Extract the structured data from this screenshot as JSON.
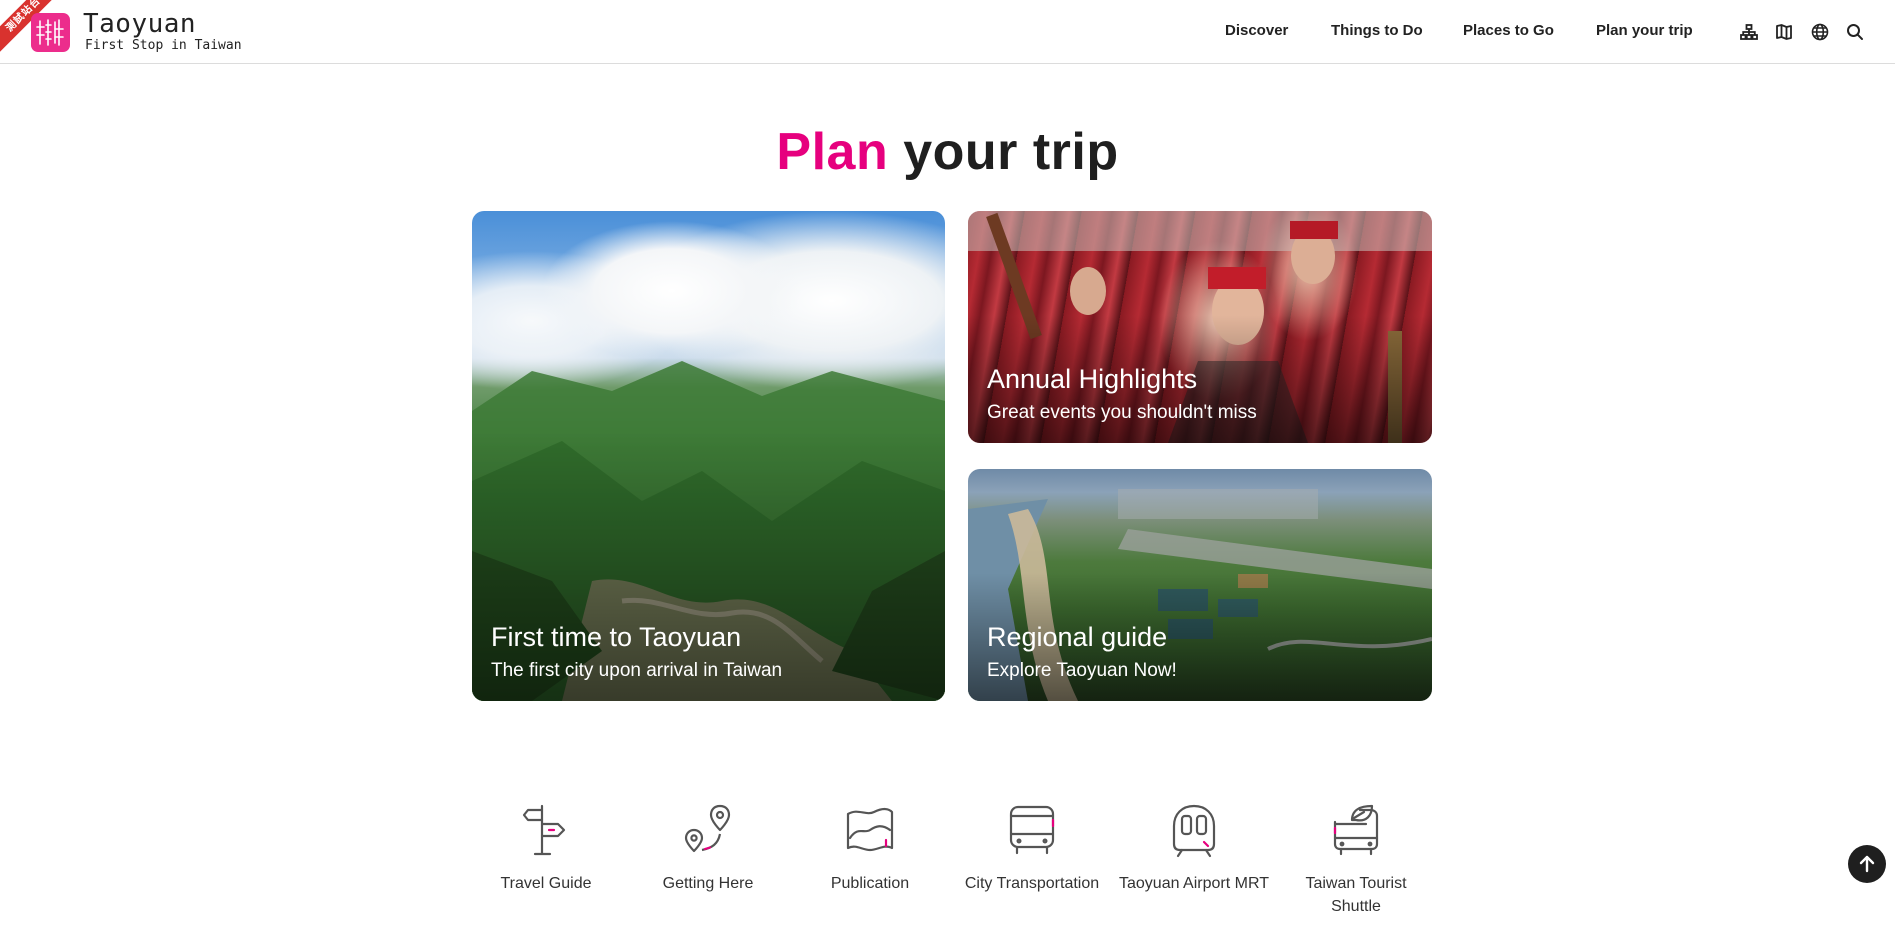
{
  "header": {
    "ribbon": "測試站台",
    "brand_title": "Taoyuan",
    "brand_tagline": "First Stop in Taiwan",
    "nav": [
      "Discover",
      "Things to Do",
      "Places to Go",
      "Plan your trip"
    ],
    "icons": [
      "sitemap-icon",
      "map-icon",
      "globe-icon",
      "search-icon"
    ]
  },
  "title": {
    "accent": "Plan",
    "rest": "your trip"
  },
  "cards": [
    {
      "title": "First time to Taoyuan",
      "subtitle": "The first city upon arrival in Taiwan"
    },
    {
      "title": "Annual Highlights",
      "subtitle": "Great events you shouldn't miss"
    },
    {
      "title": "Regional guide",
      "subtitle": "Explore Taoyuan Now!"
    }
  ],
  "quick_links": [
    {
      "label": "Travel Guide",
      "icon": "signpost-icon"
    },
    {
      "label": "Getting Here",
      "icon": "route-pins-icon"
    },
    {
      "label": "Publication",
      "icon": "folded-map-icon"
    },
    {
      "label": "City Transportation",
      "icon": "bus-icon"
    },
    {
      "label": "Taoyuan Airport MRT",
      "icon": "metro-train-icon"
    },
    {
      "label": "Taiwan Tourist Shuttle",
      "icon": "eco-bus-icon"
    }
  ],
  "colors": {
    "accent": "#e6007e",
    "brand": "#ec2d8c",
    "ribbon": "#d9322e"
  }
}
